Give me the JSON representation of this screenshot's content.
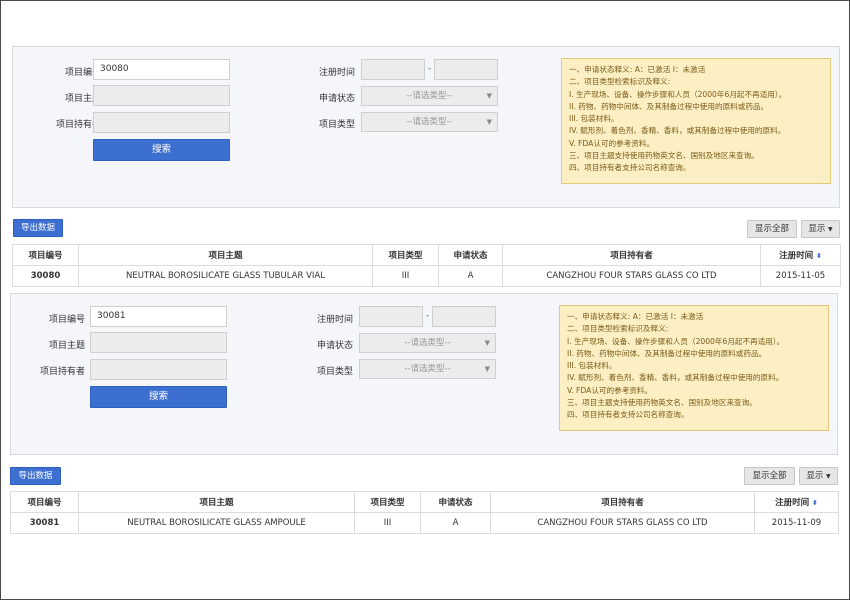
{
  "search": {
    "labels": {
      "project_no": "项目编号",
      "project_subject": "项目主题",
      "project_holder": "项目持有者",
      "reg_time": "注册时间",
      "apply_status": "申请状态",
      "project_type": "项目类型"
    },
    "search_button": "搜索",
    "date_separator": "-",
    "select_placeholder": "--请选类型--"
  },
  "toolbar": {
    "export": "导出数据",
    "show_all": "显示全部",
    "display": "显示"
  },
  "notes": [
    "一、申请状态释义:    A：已激活     I：未激活",
    "二、项目类型检索标识及释义:",
    "   I.    生产现场、设备、操作步骤和人员（2000年6月起不再适用）。",
    "   II.    药物、药物中间体、及其制备过程中使用的原料或药品。",
    "   III. 包装材料。",
    "   IV.    赋形剂、着色剂、香精、香料，或其制备过程中使用的原料。",
    "   V.  FDA认可的参考资料。",
    "三、项目主题支持使用药物英文名、国别及地区来查询。",
    "四、项目持有者支持公司名称查询。"
  ],
  "table_headers": [
    "项目编号",
    "项目主题",
    "项目类型",
    "申请状态",
    "项目持有者",
    "注册时间"
  ],
  "sort_icon": "sort-icon",
  "records": [
    {
      "project_no_input": "30080",
      "row": [
        "30080",
        "NEUTRAL BOROSILICATE GLASS TUBULAR VIAL",
        "III",
        "A",
        "CANGZHOU FOUR STARS GLASS CO LTD",
        "2015-11-05"
      ]
    },
    {
      "project_no_input": "30081",
      "row": [
        "30081",
        "NEUTRAL BOROSILICATE GLASS AMPOULE",
        "III",
        "A",
        "CANGZHOU FOUR STARS GLASS CO LTD",
        "2015-11-09"
      ]
    }
  ],
  "colors": {
    "primary": "#3d6fd1",
    "note_bg": "#fcefc4",
    "note_text": "#7a5a16"
  }
}
